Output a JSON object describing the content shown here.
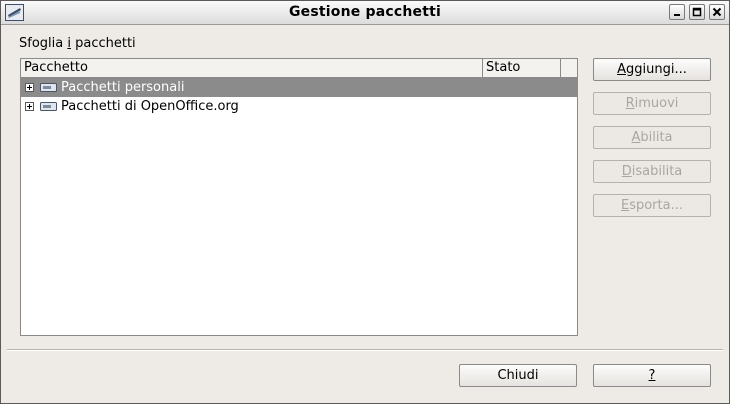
{
  "window": {
    "title": "Gestione pacchetti"
  },
  "browse_label": {
    "before": "Sfoglia ",
    "mnemonic": "i",
    "after": " pacchetti"
  },
  "list": {
    "columns": [
      "Pacchetto",
      "Stato",
      ""
    ],
    "rows": [
      {
        "label": "Pacchetti personali",
        "status": "",
        "selected": true,
        "icon": "package-icon"
      },
      {
        "label": "Pacchetti di OpenOffice.org",
        "status": "",
        "selected": false,
        "icon": "package-icon"
      }
    ]
  },
  "side_buttons": [
    {
      "mnemonic": "A",
      "rest": "ggiungi...",
      "enabled": true
    },
    {
      "mnemonic": "R",
      "rest": "imuovi",
      "enabled": false
    },
    {
      "mnemonic": "A",
      "rest": "bilita",
      "enabled": false
    },
    {
      "mnemonic": "D",
      "rest": "isabilita",
      "enabled": false
    },
    {
      "mnemonic": "E",
      "rest": "sporta...",
      "enabled": false
    }
  ],
  "bottom_buttons": {
    "close_label": "Chiudi",
    "help_label": "?"
  },
  "colors": {
    "selection": "#8b8b8b",
    "dialog_bg": "#eeebe7",
    "disabled_text": "#a9a6a1"
  }
}
